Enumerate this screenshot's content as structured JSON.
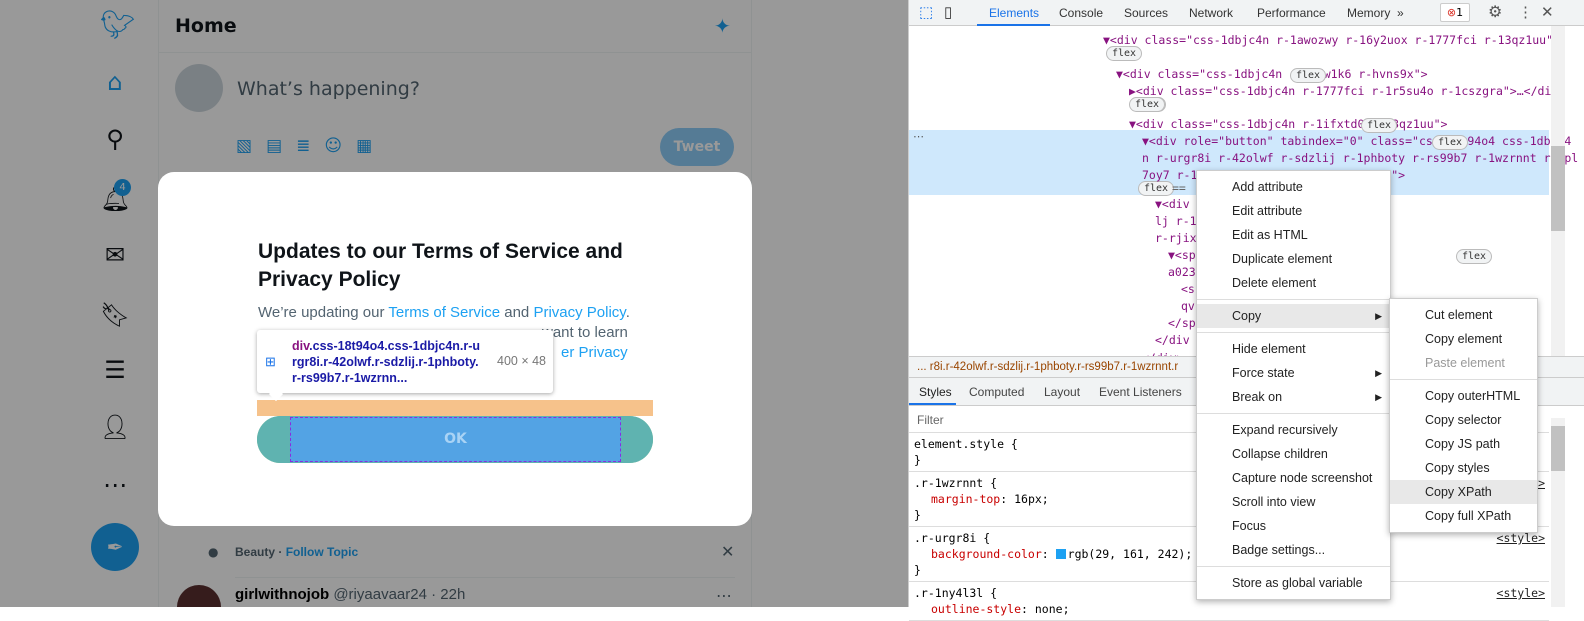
{
  "twitter": {
    "header_title": "Home",
    "compose_placeholder": "What’s happening?",
    "tweet_button": "Tweet",
    "notification_count": "4",
    "nav_icons": [
      "twitter-logo",
      "home-icon",
      "search-icon",
      "bell-icon",
      "mail-icon",
      "bookmark-icon",
      "list-icon",
      "profile-icon",
      "more-icon"
    ],
    "topic": {
      "name": "Beauty",
      "separator": " · ",
      "follow": "Follow Topic"
    },
    "tweet": {
      "user": "girlwithnojob",
      "handle": "@riyaavaar24 · 22h"
    },
    "modal": {
      "title": "Updates to our Terms of Service and Privacy Policy",
      "body_prefix": "We’re updating our ",
      "tos_link": "Terms of Service",
      "and": " and ",
      "privacy_link": "Privacy Policy",
      "period": ".",
      "line2_tail": "want to learn",
      "line3_tail": "er Privacy",
      "ok_button": "OK"
    },
    "inspect_tooltip": {
      "tag": "div",
      "selector": ".css-18t94o4.css-1dbjc4n.r-urgr8i.r-42olwf.r-sdzlij.r-1phboty.r-rs99b7.r-1wzrnn...",
      "size": "400 × 48"
    }
  },
  "devtools": {
    "tabs": [
      "Elements",
      "Console",
      "Sources",
      "Network",
      "Performance",
      "Memory"
    ],
    "active_tab": "Elements",
    "more_tabs": "»",
    "error_count": "1",
    "tree": [
      {
        "indent": 0,
        "text": "▼<div class=\"css-1dbjc4n r-1awozwy r-16y2uox r-1777fci r-13qz1uu\">"
      },
      {
        "indent": 1,
        "text": "▼<div class=\"css-1dbjc4n r-1ydw1k6 r-hvns9x\">"
      },
      {
        "indent": 2,
        "text": "▶<div class=\"css-1dbjc4n r-1777fci r-1r5su4o r-1cszgra\">…</div>"
      },
      {
        "indent": 2,
        "text": "▼<div class=\"css-1dbjc4n r-1ifxtd0 r-13qz1uu\">"
      },
      {
        "indent": 3,
        "text": "▼<div role=\"button\" tabindex=\"0\" class=\"css-18t94o4 css-1dbjc4"
      },
      {
        "indent": 3,
        "text": "n r-urgr8i r-42olwf r-sdzlij r-1phboty r-rs99b7 r-1wzrnnt r-1pl"
      },
      {
        "indent": 3,
        "text": "7oy7 r-1v6...                                  ynqc r-6416eg r-lrvibr\">"
      },
      {
        "indent": 4,
        "text": "▼<div c                                        -1awozwy r-jwli3a r-6koa"
      },
      {
        "indent": 4,
        "text": "lj r-18                                        23e6 r-b88u0q r-1777fci"
      },
      {
        "indent": 4,
        "text": "r-rjixq"
      },
      {
        "indent": 5,
        "text": "▼<spa                                       06 css-bfa6kz r-poiln3 r-"
      },
      {
        "indent": 5,
        "text": "a023e"
      },
      {
        "indent": 6,
        "text": "<s                                       406 r-poiln3 r-bcqeeo r-"
      },
      {
        "indent": 6,
        "text": "qv"
      },
      {
        "indent": 5,
        "text": "</sp"
      },
      {
        "indent": 4,
        "text": "</div"
      },
      {
        "indent": 3,
        "text": "</div>"
      }
    ],
    "badge": "flex",
    "eq": "==",
    "breadcrumb": "...  r8i.r-42olwf.r-sdzlij.r-1phboty.r-rs99b7.r-1wzrnnt.r",
    "sub_tabs": [
      "Styles",
      "Computed",
      "Layout",
      "Event Listeners"
    ],
    "filter_placeholder": "Filter",
    "styles": [
      {
        "selector": "element.style {",
        "props": [],
        "source": ""
      },
      {
        "selector": ".r-1wzrnnt {",
        "props": [
          {
            "name": "margin-top",
            "value": "16px;"
          }
        ],
        "source": "<style>"
      },
      {
        "selector": ".r-urgr8i {",
        "props": [
          {
            "name": "background-color",
            "value": "rgb(29, 161, 242);",
            "swatch": "#1da1f2"
          }
        ],
        "source": "<style>"
      },
      {
        "selector": ".r-1ny4l3l {",
        "props": [
          {
            "name": "outline-style",
            "value": "none;"
          }
        ],
        "source": "<style>"
      }
    ],
    "context_menu": {
      "groups": [
        [
          "Add attribute",
          "Edit attribute",
          "Edit as HTML",
          "Duplicate element",
          "Delete element"
        ],
        [
          "Copy"
        ],
        [
          "Hide element",
          "Force state",
          "Break on"
        ],
        [
          "Expand recursively",
          "Collapse children",
          "Capture node screenshot",
          "Scroll into view",
          "Focus",
          "Badge settings..."
        ],
        [
          "Store as global variable"
        ]
      ],
      "submenu_items": [
        "Copy",
        "Force state",
        "Break on"
      ],
      "highlighted": "Copy"
    },
    "copy_submenu": {
      "groups": [
        [
          "Cut element",
          "Copy element",
          "Paste element"
        ],
        [
          "Copy outerHTML",
          "Copy selector",
          "Copy JS path",
          "Copy styles",
          "Copy XPath",
          "Copy full XPath"
        ]
      ],
      "disabled": "Paste element",
      "highlighted": "Copy XPath"
    }
  },
  "colors": {
    "twitter_blue": "#1da1f2",
    "devtools_selection": "#cfe8fc",
    "accent": "#1a73e8"
  }
}
